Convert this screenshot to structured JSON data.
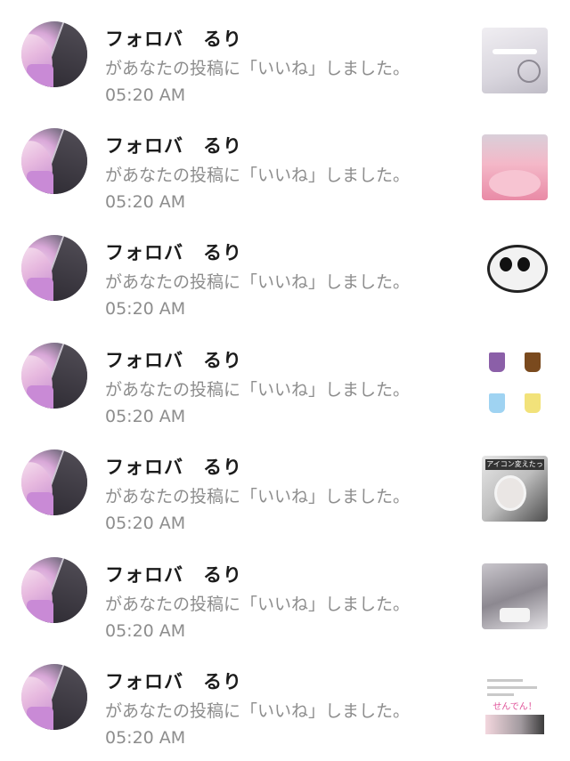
{
  "notifications": [
    {
      "user": "フォロバ　るり",
      "message": "があなたの投稿に「いいね」しました。 05:20 AM",
      "thumb": "t1",
      "caption": ""
    },
    {
      "user": "フォロバ　るり",
      "message": "があなたの投稿に「いいね」しました。 05:20 AM",
      "thumb": "t2",
      "caption": ""
    },
    {
      "user": "フォロバ　るり",
      "message": "があなたの投稿に「いいね」しました。 05:20 AM",
      "thumb": "t3",
      "caption": ""
    },
    {
      "user": "フォロバ　るり",
      "message": "があなたの投稿に「いいね」しました。 05:20 AM",
      "thumb": "t4",
      "caption": ""
    },
    {
      "user": "フォロバ　るり",
      "message": "があなたの投稿に「いいね」しました。 05:20 AM",
      "thumb": "t5",
      "caption": "アイコン変えたっ"
    },
    {
      "user": "フォロバ　るり",
      "message": "があなたの投稿に「いいね」しました。 05:20 AM",
      "thumb": "t6",
      "caption": ""
    },
    {
      "user": "フォロバ　るり",
      "message": "があなたの投稿に「いいね」しました。 05:20 AM",
      "thumb": "t7",
      "caption": "せんでん！"
    }
  ]
}
